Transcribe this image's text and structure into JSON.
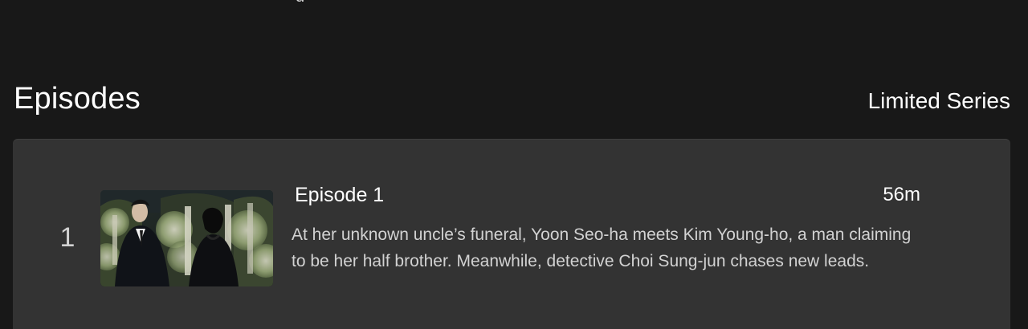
{
  "header": {
    "top_cut_text": "g"
  },
  "episodes_section": {
    "title": "Episodes",
    "series_type": "Limited Series",
    "episodes": [
      {
        "index": "1",
        "title": "Episode 1",
        "duration": "56m",
        "synopsis": "At her unknown uncle’s funeral, Yoon Seo-ha meets Kim Young-ho, a man claiming to be her half brother. Meanwhile, detective Choi Sung-jun chases new leads.",
        "thumbnail_icon": "episode-thumbnail-icon"
      }
    ]
  },
  "colors": {
    "background": "#181818",
    "card_background": "#333333",
    "primary_text": "#ffffff",
    "secondary_text": "#d2d2d2"
  }
}
